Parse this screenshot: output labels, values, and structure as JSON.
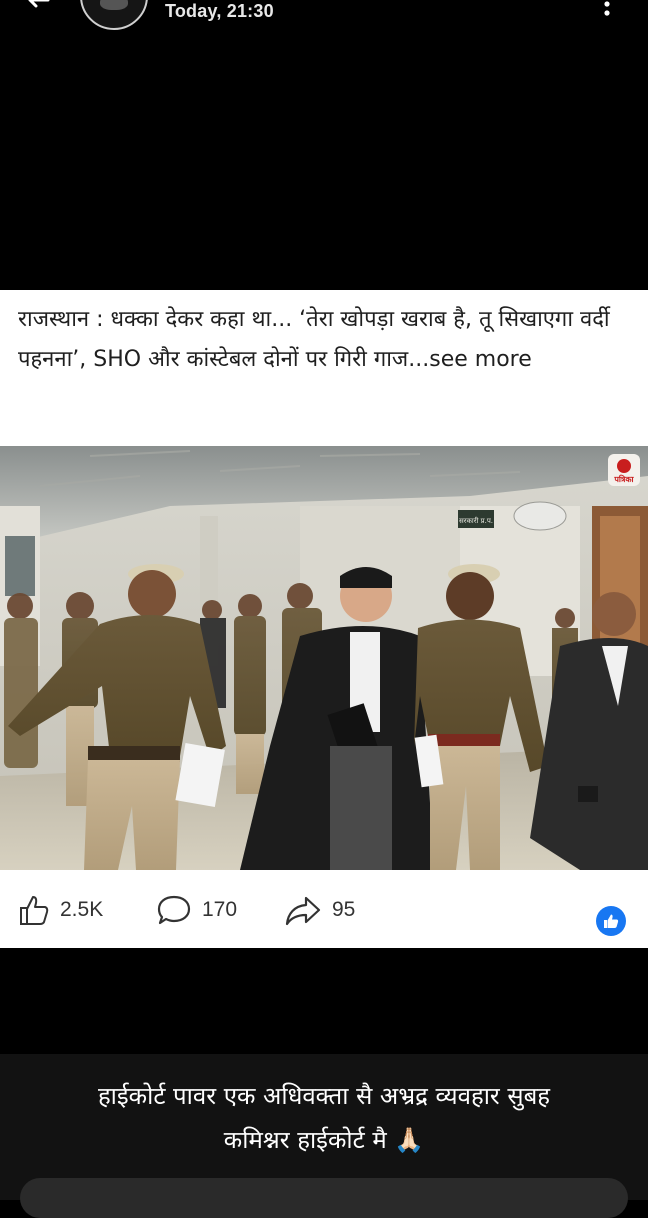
{
  "header": {
    "timestamp": "Today, 21:30",
    "back_icon": "back-arrow-icon",
    "more_icon": "more-vertical-icon"
  },
  "post": {
    "caption_main": "राजस्थान : धक्का देकर कहा था... ‘तेरा खोपड़ा खराब है, तू सिखाएगा वर्दी पहनना’, SHO और कांस्टेबल दोनों पर गिरी गाज",
    "see_more": "...see more",
    "photo_logo_text": "पत्रिका",
    "photo_sign_text": "सरकारी प्र.प.",
    "reactions": {
      "likes": "2.5K",
      "comments": "170",
      "shares": "95"
    }
  },
  "status_caption": {
    "line1": "हाईकोर्ट पावर एक अधिवक्ता सै अभ्रद्र व्यवहार सुबह",
    "line2": "कमिश्नर हाईकोर्ट मै 🙏🏻"
  },
  "colors": {
    "background": "#000000",
    "card": "#ffffff",
    "facebook_blue": "#1877f2",
    "uniform_khaki": "#6b5a3a"
  }
}
